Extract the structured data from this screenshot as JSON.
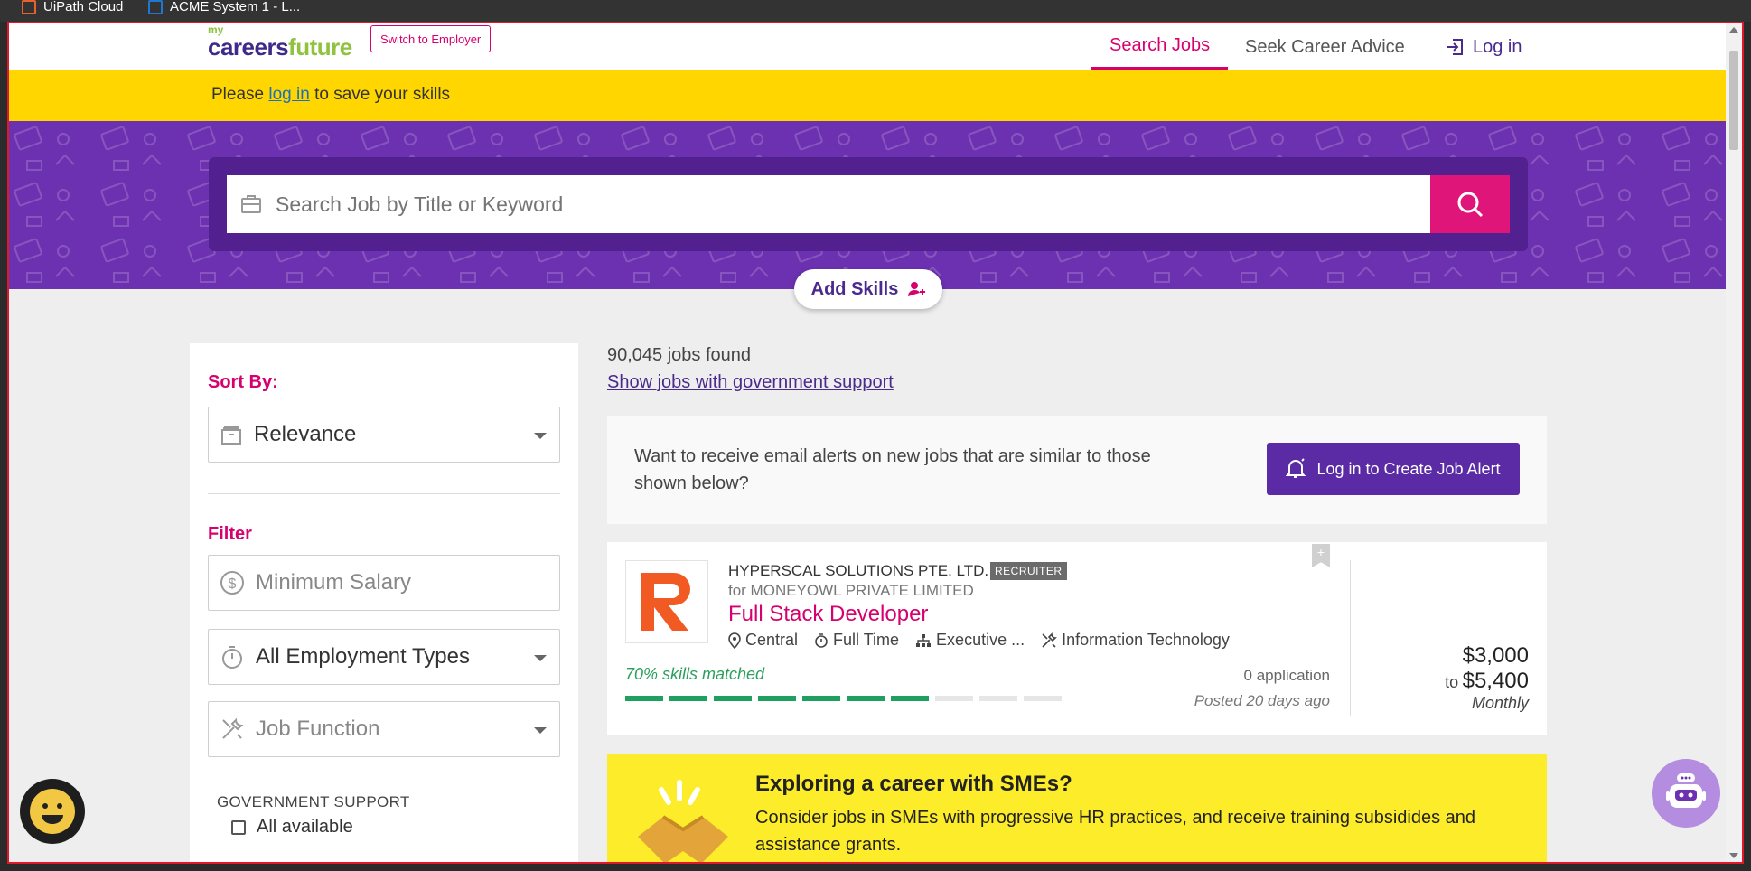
{
  "taskbar": {
    "items": [
      {
        "label": "UiPath Cloud",
        "icon": "uipath-icon"
      },
      {
        "label": "ACME System 1 - L...",
        "icon": "uipath-icon"
      }
    ]
  },
  "header": {
    "logo_my": "my",
    "logo_careers": "careers",
    "logo_future": "future",
    "switch_label": "Switch to Employer",
    "nav": {
      "search_jobs": "Search Jobs",
      "career_advice": "Seek Career Advice",
      "login": "Log in"
    }
  },
  "banner": {
    "prefix": "Please",
    "link": "log in",
    "suffix": "to save your skills"
  },
  "search": {
    "placeholder": "Search Job by Title or Keyword",
    "add_skills_label": "Add Skills"
  },
  "sidebar": {
    "sort_heading": "Sort By:",
    "sort_value": "Relevance",
    "filter_heading": "Filter",
    "min_salary_placeholder": "Minimum Salary",
    "employment_value": "All Employment Types",
    "job_function_value": "Job Function",
    "gov_support_heading": "GOVERNMENT SUPPORT",
    "gov_option": "All available"
  },
  "results": {
    "count": "90,045 jobs found",
    "gov_link": "Show jobs with government support",
    "alert_text": "Want to receive email alerts on new jobs that are similar to those shown below?",
    "alert_button": "Log in to Create Job Alert"
  },
  "job": {
    "company": "HYPERSCAL SOLUTIONS PTE. LTD.",
    "badge": "RECRUITER",
    "for_company": "for MONEYOWL PRIVATE LIMITED",
    "title": "Full Stack Developer",
    "location": "Central",
    "employment": "Full Time",
    "level": "Executive ...",
    "category": "Information Technology",
    "skills_match": "70% skills matched",
    "skills_fraction": 0.7,
    "applications": "0 application",
    "posted": "Posted 20 days ago",
    "salary_min": "$3,000",
    "salary_to": "to",
    "salary_max": "$5,400",
    "salary_period": "Monthly",
    "bookmark_symbol": "+"
  },
  "sme": {
    "title": "Exploring a career with SMEs?",
    "description": "Consider jobs in SMEs with progressive HR practices, and receive training subsidides and assistance grants."
  },
  "colors": {
    "brand_purple": "#6c31b0",
    "brand_magenta": "#d6006e",
    "banner_yellow": "#ffd600",
    "match_green": "#20a060",
    "sme_yellow": "#fdec2a"
  }
}
